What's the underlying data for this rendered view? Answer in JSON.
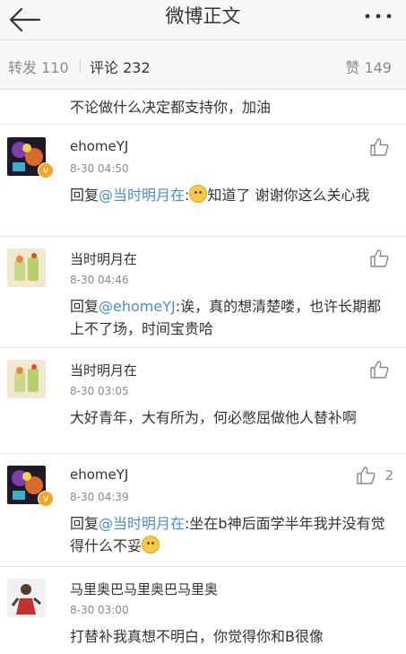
{
  "header": {
    "title": "微博正文",
    "back_icon": "back-arrow-icon",
    "more_icon": "more-dots-icon"
  },
  "tabs": {
    "repost": "转发 110",
    "comments": "评论 232",
    "likes": "赞 149"
  },
  "partial_comment": {
    "text": "不论做什么决定都支持你，加油"
  },
  "comments": [
    {
      "name": "ehomeYJ",
      "time": "8-30 04:50",
      "reply_prefix": "回复",
      "mention": "@当时明月在",
      "text_after_mention": ":",
      "text_after_emoji": "知道了 谢谢你这么关心我",
      "like_count": ""
    },
    {
      "name": "当时明月在",
      "time": "8-30 04:46",
      "reply_prefix": "回复",
      "mention": "@ehomeYJ",
      "text_after_mention": ":诶，真的想清楚喽，也许长期都上不了场，时间宝贵哈",
      "like_count": ""
    },
    {
      "name": "当时明月在",
      "time": "8-30 03:05",
      "text": "大好青年，大有所为，何必憋屈做他人替补啊",
      "like_count": ""
    },
    {
      "name": "ehomeYJ",
      "time": "8-30 04:39",
      "reply_prefix": "回复",
      "mention": "@当时明月在",
      "text_after_mention": ":坐在b神后面学半年我并没有觉得什么不妥",
      "like_count": "2"
    },
    {
      "name": "马里奥巴马里奥巴马里奥",
      "time": "8-30 03:00",
      "text": "打替补我真想不明白，你觉得你和B很像",
      "like_count": ""
    }
  ],
  "colors": {
    "mention": "#4a8dd6",
    "verified_badge": "#f4a623",
    "header_bg": "#f7f7f7"
  }
}
